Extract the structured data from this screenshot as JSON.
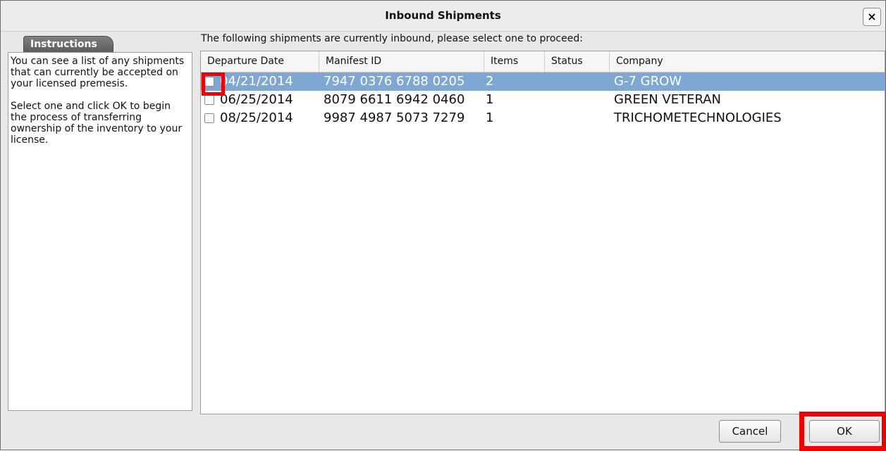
{
  "window": {
    "title": "Inbound Shipments",
    "close_label": "×"
  },
  "sidebar": {
    "tab_label": "Instructions",
    "paragraphs": [
      "You can see a list of any shipments that can currently be accepted on your licensed premesis.",
      "Select one and click OK to begin the process of transferring ownership of the inventory to your license."
    ]
  },
  "main": {
    "prompt": "The following shipments are currently inbound, please select one to proceed:",
    "columns": [
      "Departure Date",
      "Manifest ID",
      "Items",
      "Status",
      "Company"
    ],
    "rows": [
      {
        "date": "04/21/2014",
        "manifest": "7947 0376 6788 0205",
        "items": "2",
        "status": "",
        "company": "G-7 GROW",
        "selected": true
      },
      {
        "date": "06/25/2014",
        "manifest": "8079 6611 6942 0460",
        "items": "1",
        "status": "",
        "company": "GREEN VETERAN",
        "selected": false
      },
      {
        "date": "08/25/2014",
        "manifest": "9987 4987 5073 7279",
        "items": "1",
        "status": "",
        "company": "TRICHOMETECHNOLOGIES",
        "selected": false
      }
    ]
  },
  "footer": {
    "cancel_label": "Cancel",
    "ok_label": "OK"
  },
  "colors": {
    "selection": "#7fa7d3",
    "highlight": "#ee0000"
  }
}
